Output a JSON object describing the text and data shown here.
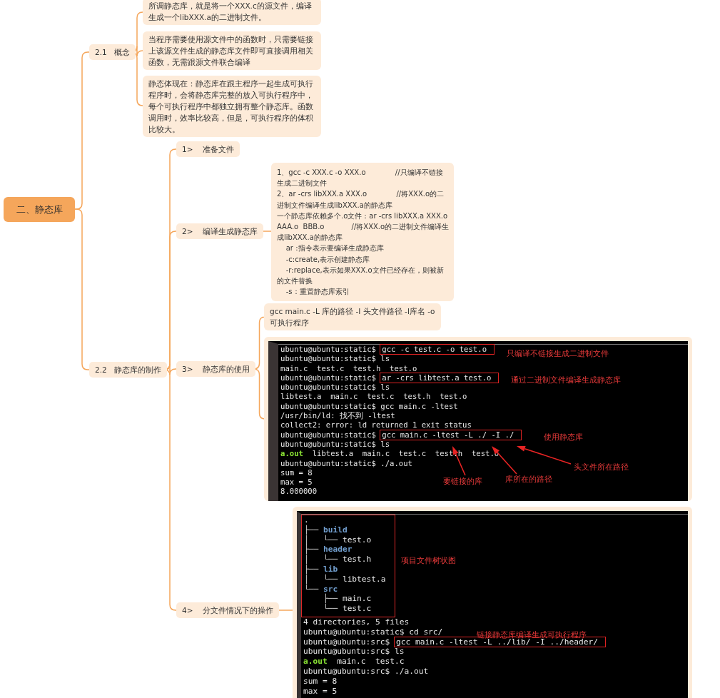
{
  "root": {
    "label": "二、静态库"
  },
  "sections": [
    {
      "label": "2.1   概念",
      "notes": [
        "所调静态库，就是将一个XXX.c的源文件，编译生成一个libXXX.a的二进制文件。",
        "当程序需要使用源文件中的函数时，只需要链接上该源文件生成的静态库文件即可直接调用相关函数，无需跟源文件联合编译",
        "静态体现在：静态库在跟主程序一起生成可执行程序时，会将静态库完整的放入可执行程序中，每个可执行程序中都独立拥有整个静态库。函数调用时，效率比较高，但是，可执行程序的体积比较大。"
      ]
    },
    {
      "label": "2.2   静态库的制作",
      "steps": [
        {
          "label": "1>    准备文件"
        },
        {
          "label": "2>    编译生成静态库",
          "note_lines": [
            "1、gcc -c XXX.c -o XXX.o             //只编译不链接生成二进制文件",
            "2、ar -crs libXXX.a XXX.o             //将XXX.o的二进制文件编译生成libXXX.a的静态库",
            "一个静态库依赖多个.o文件：ar -crs libXXX.a XXX.o  AAA.o  BBB.o            //将XXX.o的二进制文件编译生成libXXX.a的静态库",
            "    ar :指令表示要编译生成静态库",
            "    -c:create,表示创建静态库",
            "    -r:replace,表示如果XXX.o文件已经存在，则被新的文件替换",
            "    -s：重置静态库索引"
          ]
        },
        {
          "label": "3>    静态库的使用",
          "note": "gcc main.c -L 库的路径 -I 头文件路径 -l库名 -o 可执行程序",
          "terminal": {
            "lines": [
              {
                "segments": [
                  {
                    "kind": "prompt",
                    "text": "ubuntu@ubuntu:static$"
                  },
                  {
                    "kind": "command",
                    "text": "gcc -c test.c -o test.o"
                  }
                ]
              },
              {
                "segments": [
                  {
                    "kind": "text",
                    "text": "ubuntu@ubuntu:static$ ls"
                  }
                ]
              },
              {
                "segments": [
                  {
                    "kind": "text",
                    "text": "main.c  test.c  test.h  test.o"
                  }
                ]
              },
              {
                "segments": [
                  {
                    "kind": "prompt",
                    "text": "ubuntu@ubuntu:static$"
                  },
                  {
                    "kind": "command",
                    "text": "ar -crs libtest.a test.o"
                  }
                ]
              },
              {
                "segments": [
                  {
                    "kind": "text",
                    "text": "ubuntu@ubuntu:static$ ls"
                  }
                ]
              },
              {
                "segments": [
                  {
                    "kind": "text",
                    "text": "libtest.a  main.c  test.c  test.h  test.o"
                  }
                ]
              },
              {
                "segments": [
                  {
                    "kind": "text",
                    "text": "ubuntu@ubuntu:static$ gcc main.c -ltest"
                  }
                ]
              },
              {
                "segments": [
                  {
                    "kind": "text",
                    "text": "/usr/bin/ld: 找不到 -ltest"
                  }
                ]
              },
              {
                "segments": [
                  {
                    "kind": "text",
                    "text": "collect2: error: ld returned 1 exit status"
                  }
                ]
              },
              {
                "segments": [
                  {
                    "kind": "prompt",
                    "text": "ubuntu@ubuntu:static$"
                  },
                  {
                    "kind": "command",
                    "text": "gcc main.c -ltest -L ./ -I ./"
                  }
                ]
              },
              {
                "segments": [
                  {
                    "kind": "text",
                    "text": "ubuntu@ubuntu:static$ ls"
                  }
                ]
              },
              {
                "segments": [
                  {
                    "kind": "executable",
                    "text": "a.out"
                  },
                  {
                    "kind": "text",
                    "text": "  libtest.a  main.c  test.c  test.h  test.o"
                  }
                ]
              },
              {
                "segments": [
                  {
                    "kind": "text",
                    "text": "ubuntu@ubuntu:static$ ./a.out"
                  }
                ]
              },
              {
                "segments": [
                  {
                    "kind": "text",
                    "text": "sum = 8"
                  }
                ]
              },
              {
                "segments": [
                  {
                    "kind": "text",
                    "text": "max = 5"
                  }
                ]
              },
              {
                "segments": [
                  {
                    "kind": "text",
                    "text": "8.000000"
                  }
                ]
              }
            ],
            "annotations": [
              {
                "kind": "note",
                "text": "只编译不链接生成二进制文件"
              },
              {
                "kind": "note",
                "text": "通过二进制文件编译生成静态库"
              },
              {
                "kind": "note",
                "text": "使用静态库"
              },
              {
                "kind": "pointer",
                "text": "头文件所在路径"
              },
              {
                "kind": "pointer",
                "text": "要链接的库"
              },
              {
                "kind": "pointer",
                "text": "库所在的路径"
              }
            ]
          }
        },
        {
          "label": "4>    分文件情况下的操作",
          "terminal": {
            "tree": [
              {
                "segments": [
                  {
                    "kind": "text",
                    "text": "."
                  }
                ]
              },
              {
                "segments": [
                  {
                    "kind": "branch",
                    "text": "├── "
                  },
                  {
                    "kind": "directory",
                    "text": "build"
                  }
                ]
              },
              {
                "segments": [
                  {
                    "kind": "branch",
                    "text": "│   └── "
                  },
                  {
                    "kind": "text",
                    "text": "test.o"
                  }
                ]
              },
              {
                "segments": [
                  {
                    "kind": "branch",
                    "text": "├── "
                  },
                  {
                    "kind": "directory",
                    "text": "header"
                  }
                ]
              },
              {
                "segments": [
                  {
                    "kind": "branch",
                    "text": "│   └── "
                  },
                  {
                    "kind": "text",
                    "text": "test.h"
                  }
                ]
              },
              {
                "segments": [
                  {
                    "kind": "branch",
                    "text": "├── "
                  },
                  {
                    "kind": "directory",
                    "text": "lib"
                  }
                ]
              },
              {
                "segments": [
                  {
                    "kind": "branch",
                    "text": "│   └── "
                  },
                  {
                    "kind": "text",
                    "text": "libtest.a"
                  }
                ]
              },
              {
                "segments": [
                  {
                    "kind": "branch",
                    "text": "└── "
                  },
                  {
                    "kind": "directory",
                    "text": "src"
                  }
                ]
              },
              {
                "segments": [
                  {
                    "kind": "branch",
                    "text": "    ├── "
                  },
                  {
                    "kind": "text",
                    "text": "main.c"
                  }
                ]
              },
              {
                "segments": [
                  {
                    "kind": "branch",
                    "text": "    └── "
                  },
                  {
                    "kind": "text",
                    "text": "test.c"
                  }
                ]
              }
            ],
            "lines": [
              {
                "segments": [
                  {
                    "kind": "text",
                    "text": "4 directories, 5 files"
                  }
                ]
              },
              {
                "segments": [
                  {
                    "kind": "text",
                    "text": "ubuntu@ubuntu:static$ cd src/"
                  }
                ]
              },
              {
                "segments": [
                  {
                    "kind": "prompt",
                    "text": "ubuntu@ubuntu:src$"
                  },
                  {
                    "kind": "command",
                    "text": "gcc main.c -ltest -L ../lib/ -I ../header/"
                  }
                ]
              },
              {
                "segments": [
                  {
                    "kind": "text",
                    "text": "ubuntu@ubuntu:src$ ls"
                  }
                ]
              },
              {
                "segments": [
                  {
                    "kind": "executable",
                    "text": "a.out"
                  },
                  {
                    "kind": "text",
                    "text": "  main.c  test.c"
                  }
                ]
              },
              {
                "segments": [
                  {
                    "kind": "text",
                    "text": "ubuntu@ubuntu:src$ ./a.out"
                  }
                ]
              },
              {
                "segments": [
                  {
                    "kind": "text",
                    "text": "sum = 8"
                  }
                ]
              },
              {
                "segments": [
                  {
                    "kind": "text",
                    "text": "max = 5"
                  }
                ]
              }
            ],
            "annotations": [
              {
                "kind": "note",
                "text": "项目文件树状图"
              },
              {
                "kind": "note",
                "text": "链接静态库编译生成可执行程序"
              }
            ]
          }
        }
      ]
    }
  ]
}
